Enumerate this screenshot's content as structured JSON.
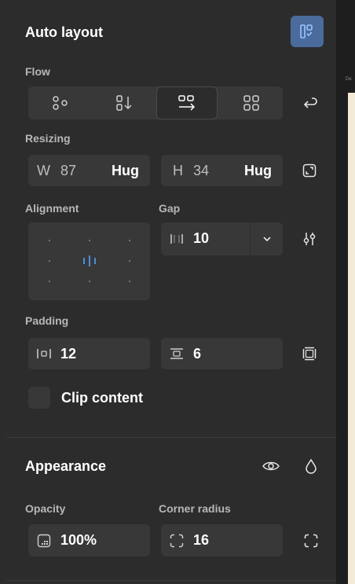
{
  "auto_layout": {
    "title": "Auto layout"
  },
  "flow": {
    "label": "Flow"
  },
  "resizing": {
    "label": "Resizing",
    "width": {
      "prefix": "W",
      "value": "87",
      "mode": "Hug"
    },
    "height": {
      "prefix": "H",
      "value": "34",
      "mode": "Hug"
    }
  },
  "alignment": {
    "label": "Alignment"
  },
  "gap": {
    "label": "Gap",
    "value": "10"
  },
  "padding": {
    "label": "Padding",
    "horizontal": "12",
    "vertical": "6"
  },
  "clip": {
    "label": "Clip content",
    "checked": false
  },
  "appearance": {
    "title": "Appearance"
  },
  "opacity": {
    "label": "Opacity",
    "value": "100%"
  },
  "corner_radius": {
    "label": "Corner radius",
    "value": "16"
  },
  "colors": {
    "panel": "#2c2c2c",
    "field": "#383838",
    "accent": "#4a90d9"
  }
}
